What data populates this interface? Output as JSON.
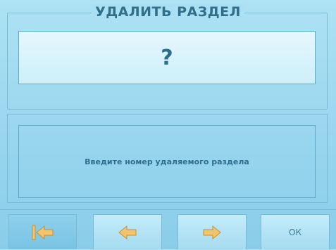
{
  "dialog": {
    "title": "УДАЛИТЬ РАЗДЕЛ",
    "input_value": "?",
    "message": "Введите номер удаляемого раздела"
  },
  "buttons": {
    "first_icon": "first-page-icon",
    "prev_icon": "arrow-left-icon",
    "next_icon": "arrow-right-icon",
    "ok_label": "ОК"
  },
  "colors": {
    "background": "#9cd8ef",
    "text": "#2f6f8c",
    "icon_fill": "#f2c46c"
  }
}
